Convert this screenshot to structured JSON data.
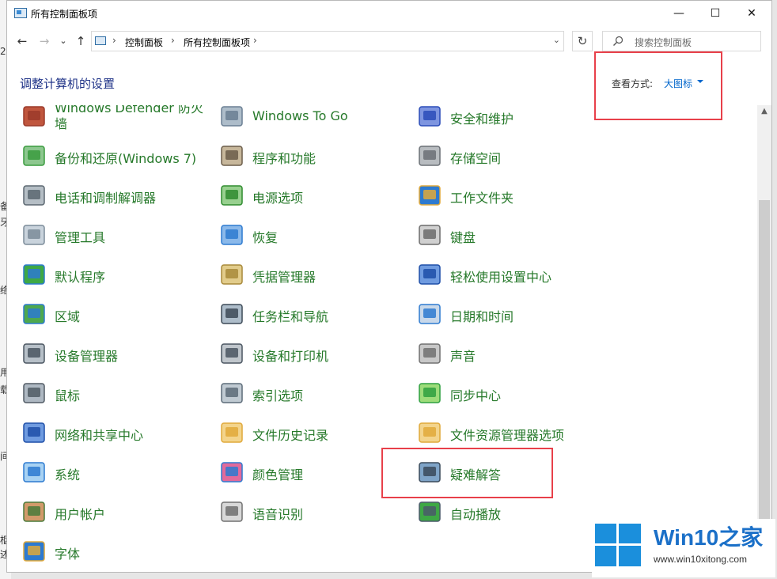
{
  "window": {
    "title": "所有控制面板项"
  },
  "titlebar": {
    "minimize": "—",
    "maximize": "☐",
    "close": "✕"
  },
  "address": {
    "back": "←",
    "forward": "→",
    "recent": "⌄",
    "up": "↑",
    "crumbs": [
      "控制面板",
      "所有控制面板项"
    ],
    "separator": "›",
    "dropdown": "⌄",
    "refresh": "↻"
  },
  "search": {
    "placeholder": "搜索控制面板"
  },
  "header": {
    "title": "调整计算机的设置",
    "view_label": "查看方式:",
    "view_value": "大图标"
  },
  "items": [
    {
      "label": "Windows Defender 防火墙",
      "icon": "firewall-icon",
      "column": 0,
      "row": 0
    },
    {
      "label": "Windows To Go",
      "icon": "windows-to-go-icon",
      "column": 1,
      "row": 0
    },
    {
      "label": "安全和维护",
      "icon": "security-flag-icon",
      "column": 2,
      "row": 0
    },
    {
      "label": "备份和还原(Windows 7)",
      "icon": "backup-icon",
      "column": 0,
      "row": 1
    },
    {
      "label": "程序和功能",
      "icon": "programs-icon",
      "column": 1,
      "row": 1
    },
    {
      "label": "存储空间",
      "icon": "storage-icon",
      "column": 2,
      "row": 1
    },
    {
      "label": "电话和调制解调器",
      "icon": "phone-icon",
      "column": 0,
      "row": 2
    },
    {
      "label": "电源选项",
      "icon": "power-icon",
      "column": 1,
      "row": 2
    },
    {
      "label": "工作文件夹",
      "icon": "work-folder-icon",
      "column": 2,
      "row": 2
    },
    {
      "label": "管理工具",
      "icon": "admin-tools-icon",
      "column": 0,
      "row": 3
    },
    {
      "label": "恢复",
      "icon": "recovery-icon",
      "column": 1,
      "row": 3
    },
    {
      "label": "键盘",
      "icon": "keyboard-icon",
      "column": 2,
      "row": 3
    },
    {
      "label": "默认程序",
      "icon": "default-programs-icon",
      "column": 0,
      "row": 4
    },
    {
      "label": "凭据管理器",
      "icon": "credential-icon",
      "column": 1,
      "row": 4
    },
    {
      "label": "轻松使用设置中心",
      "icon": "ease-of-access-icon",
      "column": 2,
      "row": 4
    },
    {
      "label": "区域",
      "icon": "region-icon",
      "column": 0,
      "row": 5
    },
    {
      "label": "任务栏和导航",
      "icon": "taskbar-icon",
      "column": 1,
      "row": 5
    },
    {
      "label": "日期和时间",
      "icon": "datetime-icon",
      "column": 2,
      "row": 5
    },
    {
      "label": "设备管理器",
      "icon": "device-manager-icon",
      "column": 0,
      "row": 6
    },
    {
      "label": "设备和打印机",
      "icon": "printer-icon",
      "column": 1,
      "row": 6
    },
    {
      "label": "声音",
      "icon": "sound-icon",
      "column": 2,
      "row": 6
    },
    {
      "label": "鼠标",
      "icon": "mouse-icon",
      "column": 0,
      "row": 7
    },
    {
      "label": "索引选项",
      "icon": "index-icon",
      "column": 1,
      "row": 7
    },
    {
      "label": "同步中心",
      "icon": "sync-icon",
      "column": 2,
      "row": 7
    },
    {
      "label": "网络和共享中心",
      "icon": "network-icon",
      "column": 0,
      "row": 8
    },
    {
      "label": "文件历史记录",
      "icon": "file-history-icon",
      "column": 1,
      "row": 8
    },
    {
      "label": "文件资源管理器选项",
      "icon": "explorer-options-icon",
      "column": 2,
      "row": 8
    },
    {
      "label": "系统",
      "icon": "system-icon",
      "column": 0,
      "row": 9
    },
    {
      "label": "颜色管理",
      "icon": "color-icon",
      "column": 1,
      "row": 9
    },
    {
      "label": "疑难解答",
      "icon": "troubleshoot-icon",
      "column": 2,
      "row": 9
    },
    {
      "label": "用户帐户",
      "icon": "users-icon",
      "column": 0,
      "row": 10
    },
    {
      "label": "语音识别",
      "icon": "microphone-icon",
      "column": 1,
      "row": 10
    },
    {
      "label": "自动播放",
      "icon": "autoplay-icon",
      "column": 2,
      "row": 10
    },
    {
      "label": "字体",
      "icon": "font-icon",
      "column": 0,
      "row": 11
    }
  ],
  "watermark": {
    "brand": "Win10之家",
    "url": "www.win10xitong.com"
  },
  "colors": {
    "item_label": "#26792a",
    "title": "#1e3287",
    "link": "#0066cc",
    "highlight": "#e8404a",
    "brand": "#1b70c8"
  },
  "background_window_fragments": [
    "2",
    "备",
    "牙",
    "络",
    "用",
    "载",
    "间",
    "枢",
    "述"
  ]
}
